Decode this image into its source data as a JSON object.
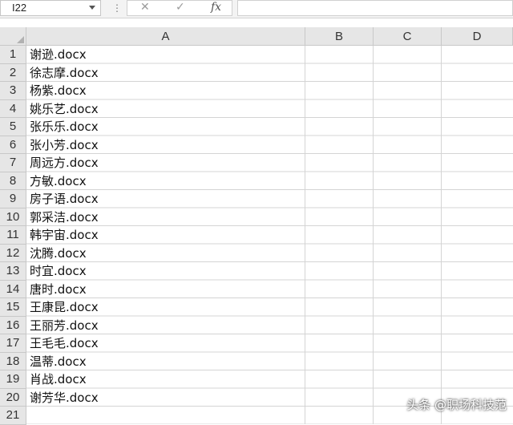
{
  "formula_bar": {
    "name_box": "I22",
    "separator_icon": "more-vertical-icon",
    "cancel_icon": "close-icon",
    "confirm_icon": "check-icon",
    "function_icon": "fx",
    "formula_value": ""
  },
  "columns": [
    "A",
    "B",
    "C",
    "D"
  ],
  "rows": [
    {
      "num": "1",
      "a": "谢逊.docx"
    },
    {
      "num": "2",
      "a": "徐志摩.docx"
    },
    {
      "num": "3",
      "a": "杨紫.docx"
    },
    {
      "num": "4",
      "a": "姚乐艺.docx"
    },
    {
      "num": "5",
      "a": "张乐乐.docx"
    },
    {
      "num": "6",
      "a": "张小芳.docx"
    },
    {
      "num": "7",
      "a": "周远方.docx"
    },
    {
      "num": "8",
      "a": "方敏.docx"
    },
    {
      "num": "9",
      "a": "房子语.docx"
    },
    {
      "num": "10",
      "a": "郭采洁.docx"
    },
    {
      "num": "11",
      "a": "韩宇宙.docx"
    },
    {
      "num": "12",
      "a": "沈腾.docx"
    },
    {
      "num": "13",
      "a": "时宜.docx"
    },
    {
      "num": "14",
      "a": "唐时.docx"
    },
    {
      "num": "15",
      "a": "王康昆.docx"
    },
    {
      "num": "16",
      "a": "王丽芳.docx"
    },
    {
      "num": "17",
      "a": "王毛毛.docx"
    },
    {
      "num": "18",
      "a": "温蒂.docx"
    },
    {
      "num": "19",
      "a": "肖战.docx"
    },
    {
      "num": "20",
      "a": "谢芳华.docx"
    },
    {
      "num": "21",
      "a": ""
    }
  ],
  "watermark": "头条 @职场科技范"
}
